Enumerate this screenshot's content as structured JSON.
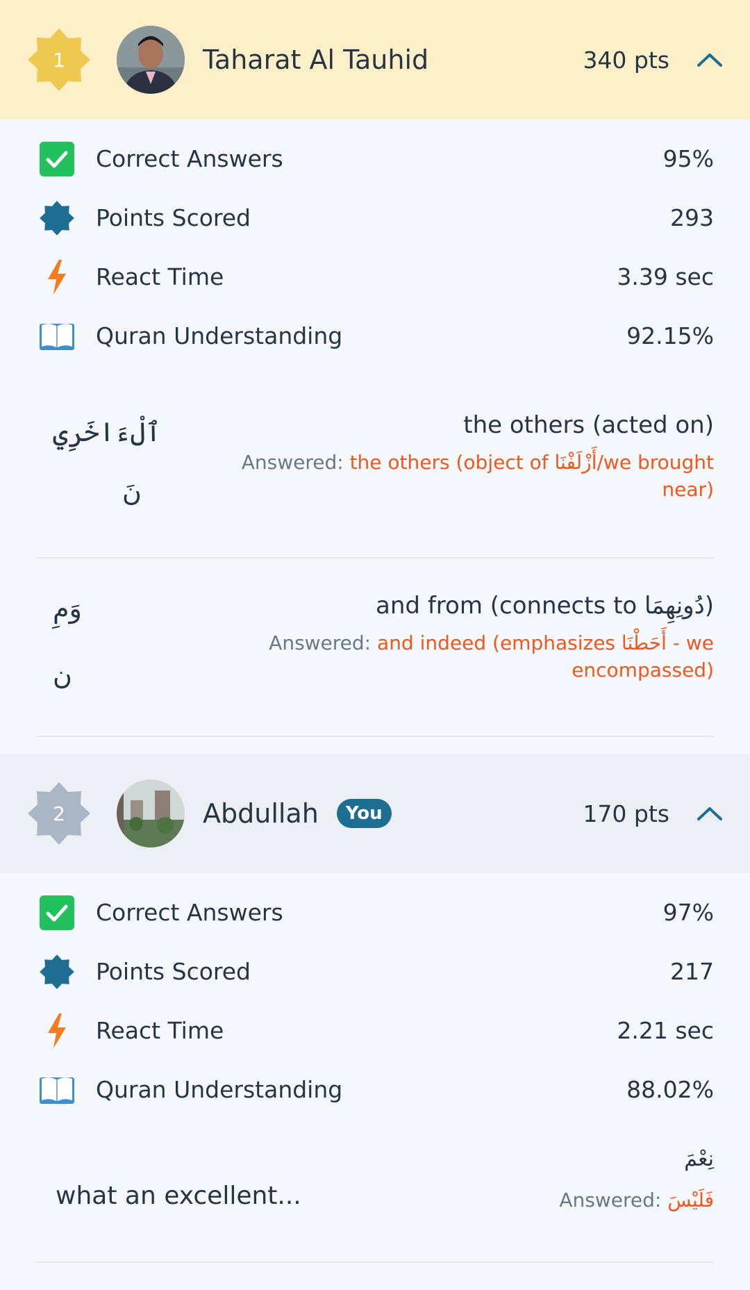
{
  "players": [
    {
      "rank": "1",
      "name": "Taharat Al Tauhid",
      "points": "340 pts",
      "stats": [
        {
          "label": "Correct Answers",
          "value": "95%",
          "icon": "check-icon"
        },
        {
          "label": "Points Scored",
          "value": "293",
          "icon": "star-badge-icon"
        },
        {
          "label": "React Time",
          "value": "3.39 sec",
          "icon": "lightning-icon"
        },
        {
          "label": "Quran Understanding",
          "value": "92.15%",
          "icon": "book-icon"
        }
      ],
      "answers": [
        {
          "arabic_line1": "ٱلْءَاخَرِي",
          "arabic_line2": "نَ",
          "question": "the others (acted on)",
          "answered_label": "Answered:",
          "answered_value_line1": "the others (object of أَزْلَفْنَا/we brought",
          "answered_value_line2": "near)"
        },
        {
          "arabic_line1": "وَمِ",
          "arabic_line2": "ن",
          "question": "and from (connects to دُونِهِمَا)",
          "answered_label": "Answered:",
          "answered_value_line1": "and indeed (emphasizes أَحَطْنَا - we",
          "answered_value_line2": "encompassed)"
        }
      ]
    },
    {
      "rank": "2",
      "name": "Abdullah",
      "badge": "You",
      "points": "170 pts",
      "stats": [
        {
          "label": "Correct Answers",
          "value": "97%",
          "icon": "check-icon"
        },
        {
          "label": "Points Scored",
          "value": "217",
          "icon": "star-badge-icon"
        },
        {
          "label": "React Time",
          "value": "2.21 sec",
          "icon": "lightning-icon"
        },
        {
          "label": "Quran Understanding",
          "value": "88.02%",
          "icon": "book-icon"
        }
      ],
      "answers": [
        {
          "arabic": "نِعْمَ",
          "question": "what an excellent...",
          "answered_label": "Answered:",
          "answered_value": "فَلَيْسَ"
        }
      ]
    }
  ],
  "colors": {
    "first_header_bg": "#fdf0c8",
    "second_header_bg": "#eceff3",
    "gold": "#eec84f",
    "silver": "#a9b6c6",
    "accent": "#1e6e93",
    "answer_orange": "#f2571b"
  }
}
